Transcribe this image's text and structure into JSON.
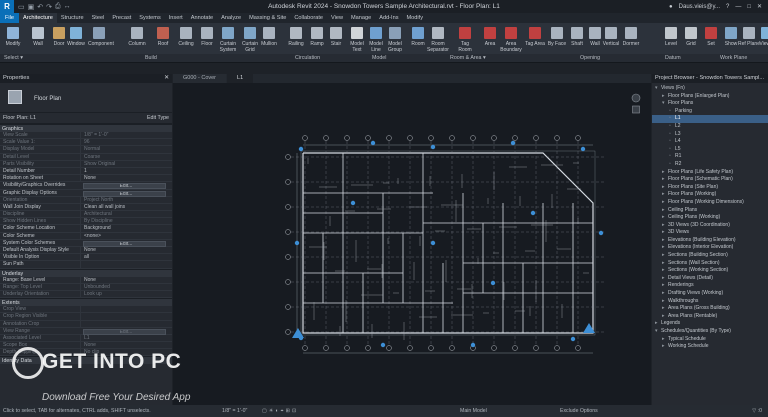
{
  "app": {
    "title": "Autodesk Revit 2024 - Snowdon Towers Sample Architectural.rvt - Floor Plan: L1",
    "user": "Daus.vieis@y...",
    "logo": "R"
  },
  "tabs": [
    "File",
    "Architecture",
    "Structure",
    "Steel",
    "Precast",
    "Systems",
    "Insert",
    "Annotate",
    "Analyze",
    "Massing & Site",
    "Collaborate",
    "View",
    "Manage",
    "Add-Ins",
    "Modify"
  ],
  "active_tab": "Architecture",
  "ribbon": {
    "buttons": [
      {
        "label": "Modify",
        "color": "#8fb4d9"
      },
      {
        "label": "Wall",
        "color": "#b9c4d0"
      },
      {
        "label": "Door",
        "color": "#c9a060"
      },
      {
        "label": "Window",
        "color": "#7fb2d8"
      },
      {
        "label": "Component",
        "color": "#8aa0b8"
      },
      {
        "label": "Column",
        "color": "#a9b3bf"
      },
      {
        "label": "Roof",
        "color": "#c06050"
      },
      {
        "label": "Ceiling",
        "color": "#a9b3bf"
      },
      {
        "label": "Floor",
        "color": "#a9b3bf"
      },
      {
        "label": "Curtain System",
        "color": "#7fa6c8"
      },
      {
        "label": "Curtain Grid",
        "color": "#7fa6c8"
      },
      {
        "label": "Mullion",
        "color": "#a9b3bf"
      },
      {
        "label": "Railing",
        "color": "#b0b8c2"
      },
      {
        "label": "Ramp",
        "color": "#b0b8c2"
      },
      {
        "label": "Stair",
        "color": "#b0b8c2"
      },
      {
        "label": "Model Text",
        "color": "#d0d4d8"
      },
      {
        "label": "Model Line",
        "color": "#6fa0d0"
      },
      {
        "label": "Model Group",
        "color": "#8aa0b8"
      },
      {
        "label": "Room",
        "color": "#6fa0d0"
      },
      {
        "label": "Room Separator",
        "color": "#b0b8c2"
      },
      {
        "label": "Tag Room",
        "color": "#c04040"
      },
      {
        "label": "Area",
        "color": "#c04040"
      },
      {
        "label": "Area Boundary",
        "color": "#c04040"
      },
      {
        "label": "Tag Area",
        "color": "#c04040"
      },
      {
        "label": "By Face",
        "color": "#a9b3bf"
      },
      {
        "label": "Shaft",
        "color": "#a9b3bf"
      },
      {
        "label": "Wall",
        "color": "#a9b3bf"
      },
      {
        "label": "Vertical",
        "color": "#a9b3bf"
      },
      {
        "label": "Dormer",
        "color": "#a9b3bf"
      },
      {
        "label": "Level",
        "color": "#c0c6cc"
      },
      {
        "label": "Grid",
        "color": "#c0c6cc"
      },
      {
        "label": "Set",
        "color": "#c04040"
      },
      {
        "label": "Show",
        "color": "#7fa6c8"
      },
      {
        "label": "Ref Plane",
        "color": "#a9b3bf"
      },
      {
        "label": "Viewer",
        "color": "#7fb2d8"
      }
    ],
    "panels": [
      "Select ▾",
      "Build",
      "Circulation",
      "Model",
      "Room & Area ▾",
      "Opening",
      "Datum",
      "Work Plane"
    ]
  },
  "properties": {
    "header": "Properties",
    "type_name": "Floor Plan",
    "selector": "Floor Plan: L1",
    "edit_type": "Edit Type",
    "groups": [
      {
        "name": "Graphics",
        "rows": [
          [
            "View Scale",
            "1/8\" = 1'-0\"",
            true
          ],
          [
            "Scale Value 1:",
            "96",
            true
          ],
          [
            "Display Model",
            "Normal",
            true
          ],
          [
            "Detail Level",
            "Coarse",
            true
          ],
          [
            "Parts Visibility",
            "Show Original",
            true
          ],
          [
            "Detail Number",
            "1",
            false
          ],
          [
            "Rotation on Sheet",
            "None",
            false
          ],
          [
            "Visibility/Graphics Overrides",
            "Edit...",
            false
          ],
          [
            "Graphic Display Options",
            "Edit...",
            false
          ],
          [
            "Orientation",
            "Project North",
            true
          ],
          [
            "Wall Join Display",
            "Clean all wall joins",
            false
          ],
          [
            "Discipline",
            "Architectural",
            true
          ],
          [
            "Show Hidden Lines",
            "By Discipline",
            true
          ],
          [
            "Color Scheme Location",
            "Background",
            false
          ],
          [
            "Color Scheme",
            "<none>",
            false
          ],
          [
            "System Color Schemes",
            "Edit...",
            false
          ],
          [
            "Default Analysis Display Style",
            "None",
            false
          ],
          [
            "Visible In Option",
            "all",
            false
          ],
          [
            "Sun Path",
            "",
            false
          ]
        ]
      },
      {
        "name": "Underlay",
        "rows": [
          [
            "Range: Base Level",
            "None",
            false
          ],
          [
            "Range: Top Level",
            "Unbounded",
            true
          ],
          [
            "Underlay Orientation",
            "Look up",
            true
          ]
        ]
      },
      {
        "name": "Extents",
        "rows": [
          [
            "Crop View",
            "",
            true
          ],
          [
            "Crop Region Visible",
            "",
            true
          ],
          [
            "Annotation Crop",
            "",
            true
          ],
          [
            "View Range",
            "Edit...",
            true
          ],
          [
            "Associated Level",
            "L1",
            true
          ],
          [
            "Scope Box",
            "None",
            true
          ],
          [
            "Depth Clipping",
            "No clip",
            true
          ]
        ]
      },
      {
        "name": "Identity Data",
        "rows": []
      }
    ]
  },
  "view_tabs": [
    "G000 - Cover",
    "L1"
  ],
  "active_view": "L1",
  "status": {
    "hint": "Click to select, TAB for alternates, CTRL adds, SHIFT unselects.",
    "scale": "1/8\" = 1'-0\"",
    "model": "Main Model",
    "options": "Exclude Options"
  },
  "browser": {
    "header": "Project Browser - Snowdon Towers Sampl...",
    "items": [
      [
        "Views (Fn)",
        0,
        "-",
        false
      ],
      [
        "Floor Plans (Enlarged Plan)",
        1,
        "+",
        false
      ],
      [
        "Floor Plans",
        1,
        "-",
        false
      ],
      [
        "Parking",
        2,
        "",
        false
      ],
      [
        "L1",
        2,
        "",
        true
      ],
      [
        "L2",
        2,
        "",
        false
      ],
      [
        "L3",
        2,
        "",
        false
      ],
      [
        "L4",
        2,
        "",
        false
      ],
      [
        "L5",
        2,
        "",
        false
      ],
      [
        "R1",
        2,
        "",
        false
      ],
      [
        "R2",
        2,
        "",
        false
      ],
      [
        "Floor Plans (Life Safety Plan)",
        1,
        "+",
        false
      ],
      [
        "Floor Plans (Schematic Plan)",
        1,
        "+",
        false
      ],
      [
        "Floor Plans (Site Plan)",
        1,
        "+",
        false
      ],
      [
        "Floor Plans (Working)",
        1,
        "+",
        false
      ],
      [
        "Floor Plans (Working Dimensions)",
        1,
        "+",
        false
      ],
      [
        "Ceiling Plans",
        1,
        "+",
        false
      ],
      [
        "Ceiling Plans (Working)",
        1,
        "+",
        false
      ],
      [
        "3D Views (3D Coordination)",
        1,
        "+",
        false
      ],
      [
        "3D Views",
        1,
        "+",
        false
      ],
      [
        "Elevations (Building Elevation)",
        1,
        "+",
        false
      ],
      [
        "Elevations (Interior Elevation)",
        1,
        "+",
        false
      ],
      [
        "Sections (Building Section)",
        1,
        "+",
        false
      ],
      [
        "Sections (Wall Section)",
        1,
        "+",
        false
      ],
      [
        "Sections (Working Section)",
        1,
        "+",
        false
      ],
      [
        "Detail Views (Detail)",
        1,
        "+",
        false
      ],
      [
        "Renderings",
        1,
        "+",
        false
      ],
      [
        "Drafting Views (Working)",
        1,
        "+",
        false
      ],
      [
        "Walkthroughs",
        1,
        "+",
        false
      ],
      [
        "Area Plans (Gross Building)",
        1,
        "+",
        false
      ],
      [
        "Area Plans (Rentable)",
        1,
        "+",
        false
      ],
      [
        "Legends",
        0,
        "+",
        false
      ],
      [
        "Schedules/Quantities (By Type)",
        0,
        "-",
        false
      ],
      [
        "Typical Schedule",
        1,
        "+",
        false
      ],
      [
        "Working Schedule",
        1,
        "+",
        false
      ]
    ]
  },
  "watermark": {
    "title": "GET INTO PC",
    "subtitle": "Download Free Your Desired App"
  }
}
